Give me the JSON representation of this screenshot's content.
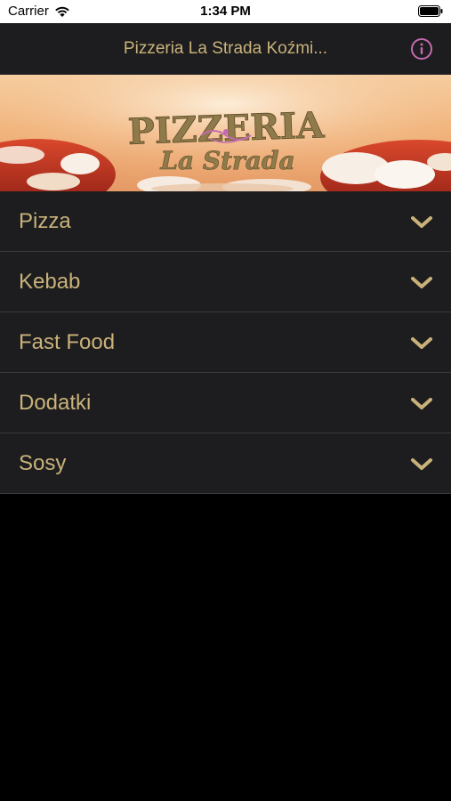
{
  "status_bar": {
    "carrier": "Carrier",
    "time": "1:34 PM"
  },
  "nav": {
    "title": "Pizzeria La Strada Koźmi...",
    "info_icon": "info-icon"
  },
  "banner": {
    "logo_text_top": "PIZZERIA",
    "logo_text_bottom": "La Strada"
  },
  "menu": {
    "items": [
      {
        "label": "Pizza",
        "icon": "chevron-down-icon"
      },
      {
        "label": "Kebab",
        "icon": "chevron-down-icon"
      },
      {
        "label": "Fast Food",
        "icon": "chevron-down-icon"
      },
      {
        "label": "Dodatki",
        "icon": "chevron-down-icon"
      },
      {
        "label": "Sosy",
        "icon": "chevron-down-icon"
      }
    ]
  },
  "colors": {
    "accent": "#c9b27a",
    "info_icon": "#c46bb0",
    "row_background": "#1d1d1f",
    "page_background": "#000000"
  }
}
